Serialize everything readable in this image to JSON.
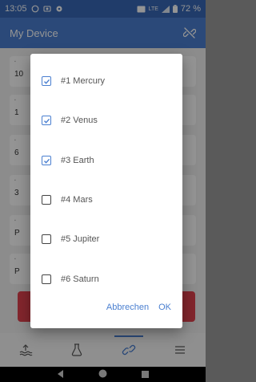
{
  "status_bar": {
    "time": "13:05",
    "network": "LTE",
    "battery": "72 %"
  },
  "app_bar": {
    "title": "My Device"
  },
  "background_cards": [
    {
      "value": "10"
    },
    {
      "value": "1"
    },
    {
      "value": "6"
    },
    {
      "value": "3"
    },
    {
      "value": "P"
    },
    {
      "value": "P"
    }
  ],
  "dialog": {
    "options": [
      {
        "label": "#1 Mercury",
        "checked": true
      },
      {
        "label": "#2 Venus",
        "checked": true
      },
      {
        "label": "#3 Earth",
        "checked": true
      },
      {
        "label": "#4 Mars",
        "checked": false
      },
      {
        "label": "#5 Jupiter",
        "checked": false
      },
      {
        "label": "#6 Saturn",
        "checked": false
      }
    ],
    "cancel_label": "Abbrechen",
    "ok_label": "OK"
  },
  "bottom_nav": {
    "items": [
      {
        "icon": "upload-icon",
        "active": false
      },
      {
        "icon": "flask-icon",
        "active": false
      },
      {
        "icon": "link-icon",
        "active": true
      },
      {
        "icon": "menu-icon",
        "active": false
      }
    ]
  },
  "colors": {
    "accent": "#4a7fd0",
    "status_bar": "#3768b7",
    "danger": "#e2434f"
  }
}
